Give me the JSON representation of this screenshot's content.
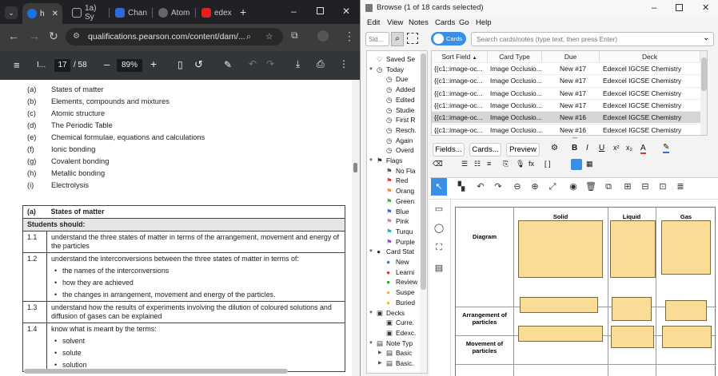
{
  "browser": {
    "tabs": [
      {
        "label": "h",
        "active": true
      },
      {
        "label": "1a) Sy"
      },
      {
        "label": "Chan"
      },
      {
        "label": "Atom"
      },
      {
        "label": "edex"
      }
    ],
    "address": "qualifications.pearson.com/content/dam/...",
    "pdf": {
      "title": "I...",
      "page": "17",
      "page_total": "/ 58",
      "zoom": "89%"
    },
    "toc": [
      {
        "k": "(a)",
        "t": "States of matter"
      },
      {
        "k": "(b)",
        "t": "Elements, compounds and mixtures"
      },
      {
        "k": "(c)",
        "t": "Atomic structure"
      },
      {
        "k": "(d)",
        "t": "The Periodic Table"
      },
      {
        "k": "(e)",
        "t": "Chemical formulae, equations and calculations"
      },
      {
        "k": "(f)",
        "t": "Ionic bonding"
      },
      {
        "k": "(g)",
        "t": "Covalent bonding"
      },
      {
        "k": "(h)",
        "t": "Metallic bonding"
      },
      {
        "k": "(i)",
        "t": "Electrolysis"
      }
    ],
    "spec": {
      "section_key": "(a)",
      "section_title": "States of matter",
      "students_should": "Students should:",
      "rows": [
        {
          "num": "1.1",
          "text": "understand the three states of matter in terms of the arrangement, movement and energy of the particles"
        },
        {
          "num": "1.2",
          "text": "understand the interconversions between the three states of matter in terms of:",
          "bullets": [
            "the names of the interconversions",
            "how they are achieved",
            "the changes in arrangement, movement and energy of the particles."
          ]
        },
        {
          "num": "1.3",
          "text": "understand how the results of experiments involving the dilution of coloured solutions and diffusion of gases can be explained"
        },
        {
          "num": "1.4",
          "text": "know what is meant by the terms:",
          "bullets": [
            "solvent",
            "solute",
            "solution"
          ]
        }
      ]
    }
  },
  "anki": {
    "title": "Browse (1 of 18 cards selected)",
    "menu": [
      "Edit",
      "View",
      "Notes",
      "Cards",
      "Go",
      "Help"
    ],
    "sidebar_search_placeholder": "Sid...",
    "toggle_label": "Cards",
    "search_placeholder": "Search cards/notes (type text, then press Enter)",
    "sidebar": [
      {
        "label": "Saved Se",
        "icon": "heart-icon",
        "indent": 1
      },
      {
        "label": "Today",
        "icon": "clock-icon",
        "indent": 1,
        "expander": "v"
      },
      {
        "label": "Due",
        "icon": "clock-icon",
        "indent": 2
      },
      {
        "label": "Added",
        "icon": "clock-icon",
        "indent": 2
      },
      {
        "label": "Edited",
        "icon": "clock-icon",
        "indent": 2
      },
      {
        "label": "Studie",
        "icon": "clock-icon",
        "indent": 2
      },
      {
        "label": "First R",
        "icon": "clock-icon",
        "indent": 2
      },
      {
        "label": "Resch.",
        "icon": "clock-icon",
        "indent": 2
      },
      {
        "label": "Again",
        "icon": "clock-icon",
        "indent": 2
      },
      {
        "label": "Overd",
        "icon": "clock-icon",
        "indent": 2
      },
      {
        "label": "Flags",
        "icon": "flag-icon",
        "indent": 1,
        "expander": "v"
      },
      {
        "label": "No Fla",
        "icon": "flag-icon",
        "indent": 2,
        "color": "#555555"
      },
      {
        "label": "Red",
        "icon": "flag-icon",
        "indent": 2,
        "color": "#e04040"
      },
      {
        "label": "Orang",
        "icon": "flag-icon",
        "indent": 2,
        "color": "#f09030"
      },
      {
        "label": "Green",
        "icon": "flag-icon",
        "indent": 2,
        "color": "#40b040"
      },
      {
        "label": "Blue",
        "icon": "flag-icon",
        "indent": 2,
        "color": "#3070e0"
      },
      {
        "label": "Pink",
        "icon": "flag-icon",
        "indent": 2,
        "color": "#e070c0"
      },
      {
        "label": "Turqu",
        "icon": "flag-icon",
        "indent": 2,
        "color": "#30b0b0"
      },
      {
        "label": "Purple",
        "icon": "flag-icon",
        "indent": 2,
        "color": "#9050d0"
      },
      {
        "label": "Card Stat",
        "icon": "circle-icon",
        "indent": 1,
        "expander": "v"
      },
      {
        "label": "New",
        "icon": "circle-icon",
        "indent": 2,
        "color": "#3a6fe0"
      },
      {
        "label": "Learni",
        "icon": "circle-icon",
        "indent": 2,
        "color": "#e03030"
      },
      {
        "label": "Review",
        "icon": "circle-icon",
        "indent": 2,
        "color": "#30a030"
      },
      {
        "label": "Suspe",
        "icon": "circle-icon",
        "indent": 2,
        "color": "#e0c030"
      },
      {
        "label": "Buried",
        "icon": "circle-icon",
        "indent": 2,
        "color": "#e0c030"
      },
      {
        "label": "Decks",
        "icon": "deck-icon",
        "indent": 1,
        "expander": "v"
      },
      {
        "label": "Curre.",
        "icon": "deck-icon",
        "indent": 2
      },
      {
        "label": "Edexc.",
        "icon": "deck-icon",
        "indent": 2
      },
      {
        "label": "Note Typ",
        "icon": "notetype-icon",
        "indent": 1,
        "expander": "v"
      },
      {
        "label": "Basic",
        "icon": "notetype-icon",
        "indent": 2,
        "expander": ">"
      },
      {
        "label": "Basic.",
        "icon": "notetype-icon",
        "indent": 2,
        "expander": ">"
      }
    ],
    "columns": [
      "Sort Field",
      "Card Type",
      "Due",
      "Deck"
    ],
    "rows": [
      {
        "sort": "{{c1::image-oc...",
        "type": "Image Occlusio...",
        "due": "New #17",
        "deck": "Edexcel IGCSE Chemistry"
      },
      {
        "sort": "{{c1::image-oc...",
        "type": "Image Occlusio...",
        "due": "New #17",
        "deck": "Edexcel IGCSE Chemistry"
      },
      {
        "sort": "{{c1::image-oc...",
        "type": "Image Occlusio...",
        "due": "New #17",
        "deck": "Edexcel IGCSE Chemistry"
      },
      {
        "sort": "{{c1::image-oc...",
        "type": "Image Occlusio...",
        "due": "New #17",
        "deck": "Edexcel IGCSE Chemistry"
      },
      {
        "sort": "{{c1::image-oc...",
        "type": "Image Occlusio...",
        "due": "New #16",
        "deck": "Edexcel IGCSE Chemistry",
        "selected": true
      },
      {
        "sort": "{{c1::image-oc...",
        "type": "Image Occlusio...",
        "due": "New #16",
        "deck": "Edexcel IGCSE Chemistry"
      }
    ],
    "editor_buttons": [
      "Fields...",
      "Cards...",
      "Preview"
    ],
    "occlusion": {
      "columns": [
        "Solid",
        "Liquid",
        "Gas"
      ],
      "rows": [
        "Diagram",
        "Arrangement of particles",
        "Movement of particles"
      ]
    }
  }
}
